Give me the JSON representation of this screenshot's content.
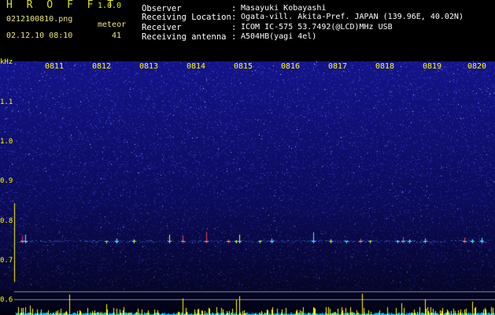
{
  "app": {
    "title": "H R O F F T",
    "version": "1.0.0"
  },
  "file": {
    "name": "0212100810.png",
    "timestamp": "02.12.10 08:10"
  },
  "meteor": {
    "label": "meteor",
    "count": "41"
  },
  "info": [
    {
      "key": "Observer",
      "value": "Masayuki Kobayashi"
    },
    {
      "key": "Receiving Location",
      "value": "Ogata-vill. Akita-Pref. JAPAN (139.96E, 40.02N)"
    },
    {
      "key": "Receiver",
      "value": "ICOM IC-575 53.7492(@LCD)MHz USB"
    },
    {
      "key": "Receiving antenna",
      "value": "A504HB(yagi 4el)"
    }
  ],
  "colon": ":",
  "chart_data": {
    "type": "heatmap",
    "ylabel": "kHz",
    "y_ticks": [
      "1.1",
      "1.0",
      "0.9",
      "0.8",
      "0.7",
      "0.6"
    ],
    "x_ticks": [
      "0811",
      "0812",
      "0813",
      "0814",
      "0815",
      "0816",
      "0817",
      "0818",
      "0819",
      "0820"
    ],
    "meteor_band_khz": 0.75,
    "background": "#0a0a4a",
    "noise_color": "#3a3acc",
    "echo_colors": [
      "#ff4040",
      "#ffff00",
      "#40ffff"
    ],
    "level_trace_color": "#ffff00",
    "noise_trace_color": "#00c8ff"
  }
}
